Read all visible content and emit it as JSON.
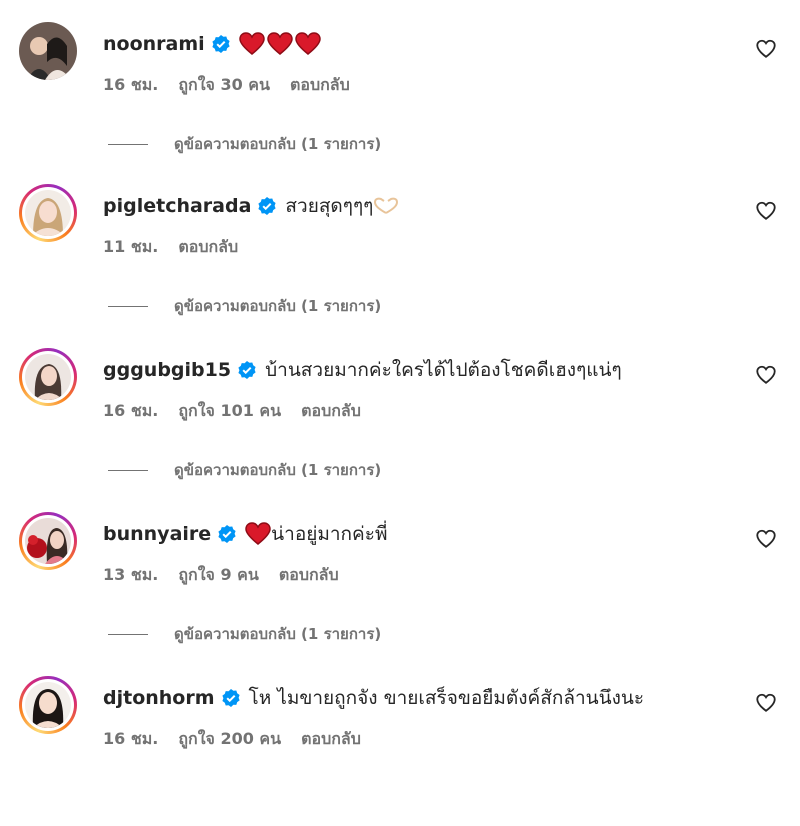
{
  "comments": [
    {
      "username": "noonrami",
      "text": "",
      "time": "16 ชม.",
      "likes": "ถูกใจ 30 คน",
      "reply": "ตอบกลับ",
      "view_replies": "ดูข้อความตอบกลับ (1 รายการ)",
      "emoji": "heart x3"
    },
    {
      "username": "pigletcharada",
      "text": "สวยสุดๆๆๆ",
      "time": "11 ชม.",
      "likes": "",
      "reply": "ตอบกลับ",
      "view_replies": "ดูข้อความตอบกลับ (1 รายการ)",
      "emoji": "heart-hands"
    },
    {
      "username": "gggubgib15",
      "text": "บ้านสวยมากค่ะใครได้ไปต้องโชคดีเฮงๆแน่ๆ",
      "time": "16 ชม.",
      "likes": "ถูกใจ 101 คน",
      "reply": "ตอบกลับ",
      "view_replies": "ดูข้อความตอบกลับ (1 รายการ)"
    },
    {
      "username": "bunnyaire",
      "text": "น่าอยู่มากค่ะพี่",
      "time": "13 ชม.",
      "likes": "ถูกใจ 9 คน",
      "reply": "ตอบกลับ",
      "view_replies": "ดูข้อความตอบกลับ (1 รายการ)",
      "emoji": "heart"
    },
    {
      "username": "djtonhorm",
      "text": "โห ไมขายถูกจัง ขายเสร็จขอยืมตังค์สักล้านนึงนะ",
      "time": "16 ชม.",
      "likes": "ถูกใจ 200 คน",
      "reply": "ตอบกลับ",
      "view_replies": ""
    }
  ],
  "colors": {
    "verified": "#0095f6",
    "meta": "#737373",
    "heart": "#e0245e"
  },
  "icons": {
    "verified": "verified-badge-icon",
    "like": "heart-outline-icon"
  }
}
